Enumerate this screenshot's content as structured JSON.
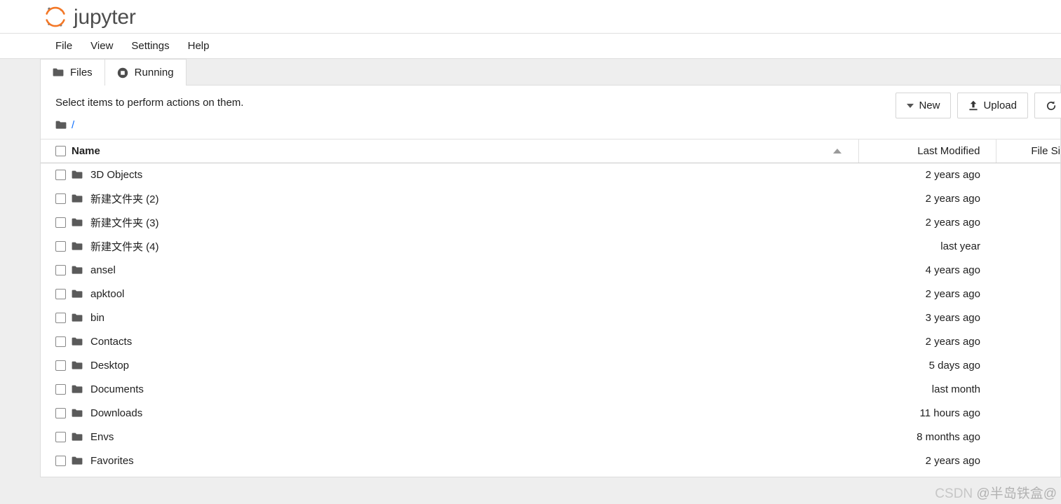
{
  "brand": {
    "name": "jupyter",
    "logo_icon": "jupyter-logo-icon",
    "accent_color": "#F37726",
    "dot_color": "#767677",
    "text_color": "#4D4D4D"
  },
  "menubar": {
    "items": [
      {
        "label": "File"
      },
      {
        "label": "View"
      },
      {
        "label": "Settings"
      },
      {
        "label": "Help"
      }
    ]
  },
  "tabs": [
    {
      "label": "Files",
      "icon": "folder-icon",
      "active": true
    },
    {
      "label": "Running",
      "icon": "running-stop-icon",
      "active": false
    }
  ],
  "panel": {
    "select_note": "Select items to perform actions on them.",
    "toolbar": {
      "new_label": "New",
      "new_icon": "caret-down-icon",
      "upload_label": "Upload",
      "upload_icon": "upload-icon",
      "refresh_label": "",
      "refresh_icon": "refresh-icon"
    },
    "breadcrumb": {
      "root_icon": "folder-icon",
      "root_label": "/"
    },
    "table": {
      "columns": {
        "name": "Name",
        "sort_indicator": "sort-ascending-icon",
        "last_modified": "Last Modified",
        "file_size": "File Si"
      },
      "rows": [
        {
          "icon": "folder-icon",
          "name": "3D Objects",
          "last_modified": "2 years ago",
          "file_size": ""
        },
        {
          "icon": "folder-icon",
          "name": "新建文件夹 (2)",
          "last_modified": "2 years ago",
          "file_size": ""
        },
        {
          "icon": "folder-icon",
          "name": "新建文件夹 (3)",
          "last_modified": "2 years ago",
          "file_size": ""
        },
        {
          "icon": "folder-icon",
          "name": "新建文件夹 (4)",
          "last_modified": "last year",
          "file_size": ""
        },
        {
          "icon": "folder-icon",
          "name": "ansel",
          "last_modified": "4 years ago",
          "file_size": ""
        },
        {
          "icon": "folder-icon",
          "name": "apktool",
          "last_modified": "2 years ago",
          "file_size": ""
        },
        {
          "icon": "folder-icon",
          "name": "bin",
          "last_modified": "3 years ago",
          "file_size": ""
        },
        {
          "icon": "folder-icon",
          "name": "Contacts",
          "last_modified": "2 years ago",
          "file_size": ""
        },
        {
          "icon": "folder-icon",
          "name": "Desktop",
          "last_modified": "5 days ago",
          "file_size": ""
        },
        {
          "icon": "folder-icon",
          "name": "Documents",
          "last_modified": "last month",
          "file_size": ""
        },
        {
          "icon": "folder-icon",
          "name": "Downloads",
          "last_modified": "11 hours ago",
          "file_size": ""
        },
        {
          "icon": "folder-icon",
          "name": "Envs",
          "last_modified": "8 months ago",
          "file_size": ""
        },
        {
          "icon": "folder-icon",
          "name": "Favorites",
          "last_modified": "2 years ago",
          "file_size": ""
        }
      ]
    }
  },
  "watermark": {
    "prefix": "CSDN",
    "handle": "@半岛铁盒@"
  }
}
